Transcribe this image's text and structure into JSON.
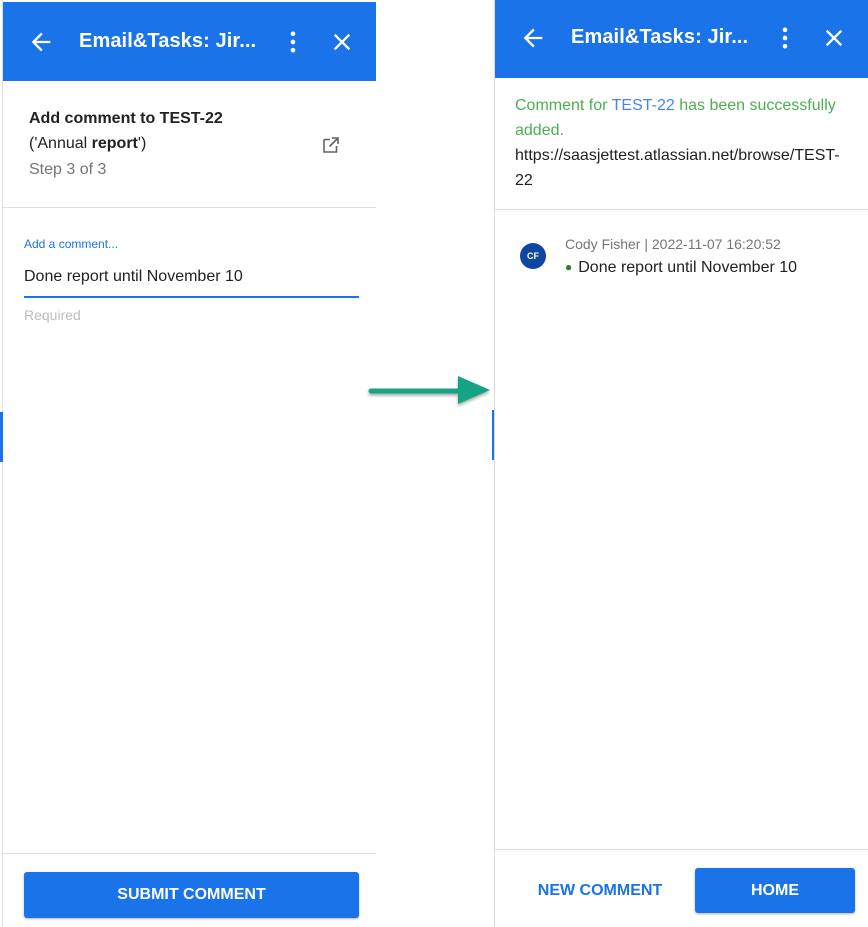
{
  "colors": {
    "app_bar": "#1a73e8",
    "accent": "#1a73e8",
    "success_text": "#4caf50",
    "link": "#4285f4",
    "arrow": "#18a383",
    "avatar": "#0d47a1"
  },
  "left_panel": {
    "app_bar": {
      "title": "Email&Tasks: Jir...",
      "back_icon": "arrow-back-icon",
      "more_icon": "more-vert-icon",
      "close_icon": "close-icon"
    },
    "header": {
      "title": "Add comment to TEST-22",
      "subtitle_prefix": "('Annual ",
      "subtitle_bold": "report",
      "subtitle_suffix": "')",
      "step": "Step 3 of 3",
      "open_icon": "open-in-new-icon"
    },
    "comment_field": {
      "label": "Add a comment...",
      "value": "Done report until November 10",
      "helper": "Required"
    },
    "submit_button": "SUBMIT COMMENT"
  },
  "right_panel": {
    "app_bar": {
      "title": "Email&Tasks: Jir...",
      "back_icon": "arrow-back-icon",
      "more_icon": "more-vert-icon",
      "close_icon": "close-icon"
    },
    "success": {
      "prefix": "Comment for ",
      "issue_key": "TEST-22",
      "suffix": " has been successfully",
      "line2": "added.",
      "url_line1": "https://saasjettest.atlassian.net/browse/TEST-",
      "url_line2": "22"
    },
    "comment": {
      "avatar_initials": "CF",
      "meta": "Cody Fisher | 2022-11-07 16:20:52",
      "bullet": "●",
      "text": "Done report until November 10"
    },
    "new_comment_button": "NEW COMMENT",
    "home_button": "HOME"
  },
  "transition_arrow_icon": "arrow-right-icon"
}
